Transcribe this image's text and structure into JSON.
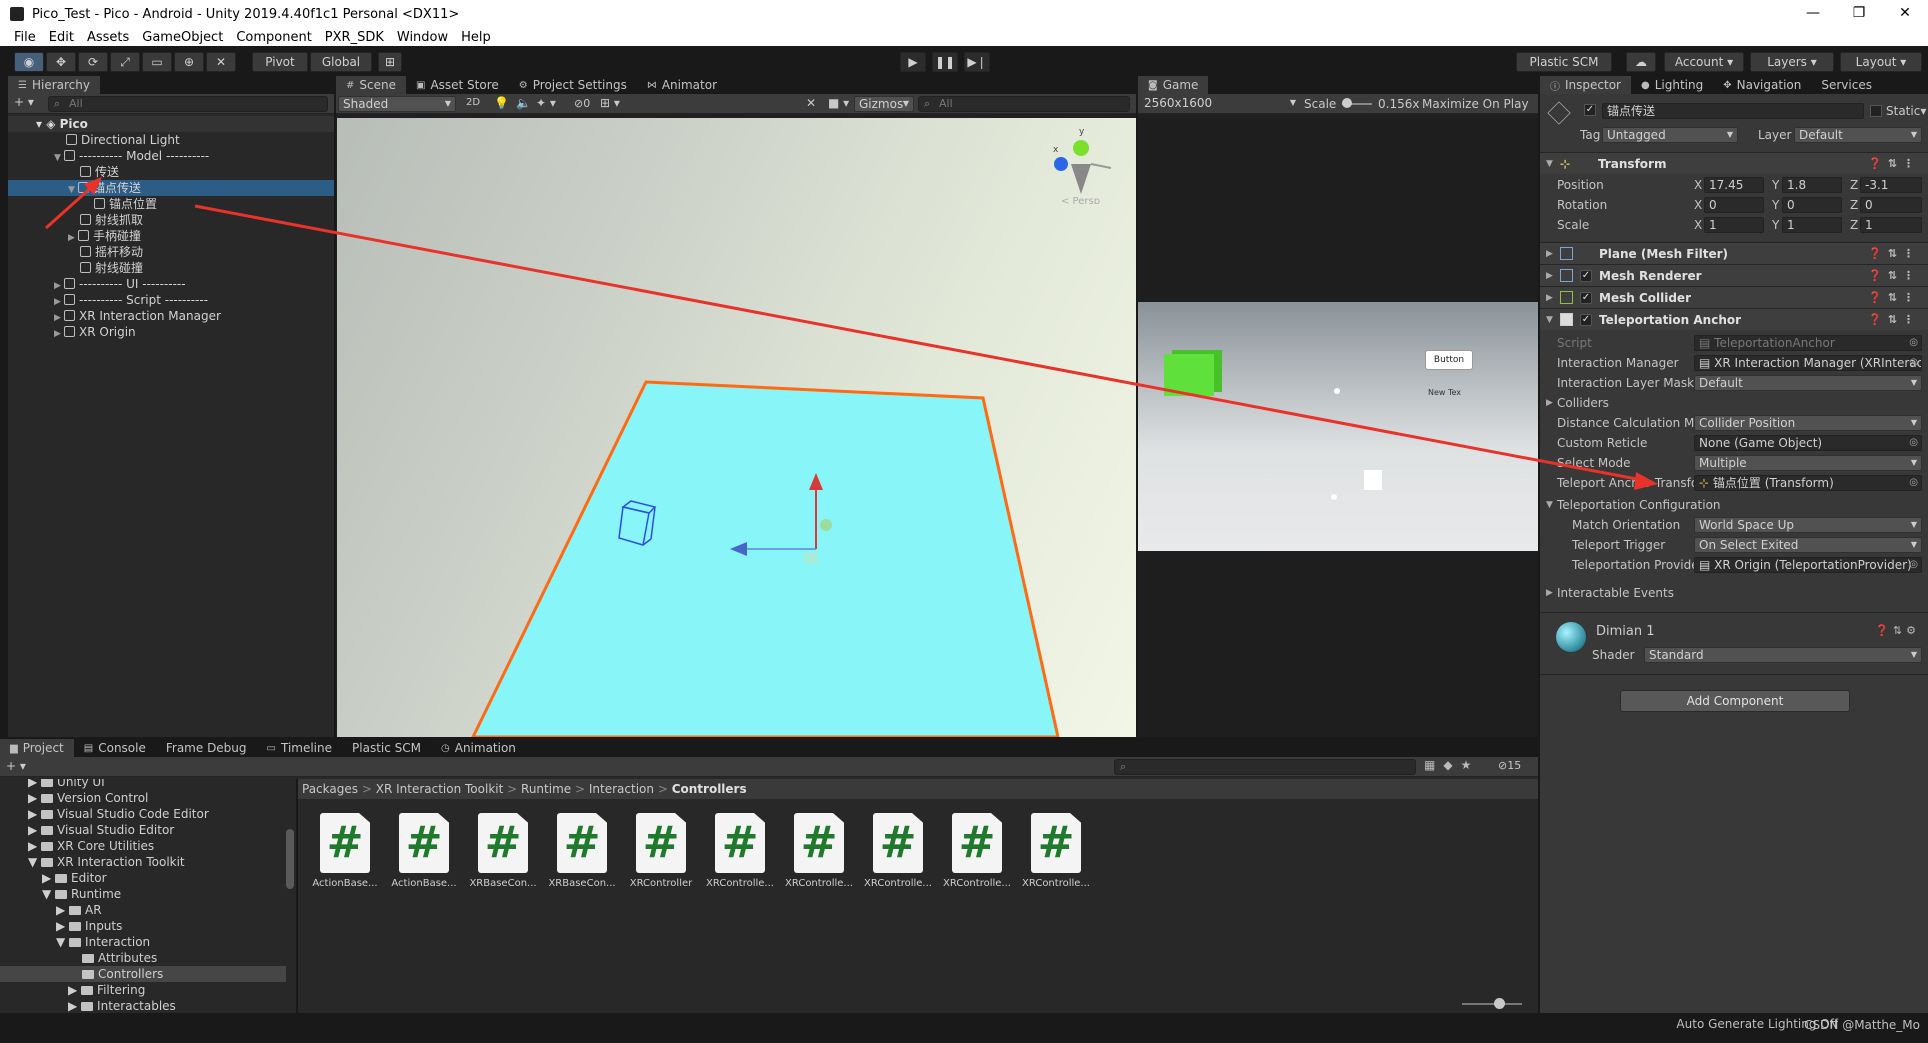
{
  "window": {
    "title": "Pico_Test - Pico - Android - Unity 2019.4.40f1c1 Personal <DX11>",
    "minimize": "—",
    "maximize": "❐",
    "close": "✕"
  },
  "menu": [
    "File",
    "Edit",
    "Assets",
    "GameObject",
    "Component",
    "PXR_SDK",
    "Window",
    "Help"
  ],
  "toolbar": {
    "pivot": "Pivot",
    "global": "Global",
    "plastic": "Plastic SCM",
    "account": "Account",
    "layers": "Layers",
    "layout": "Layout"
  },
  "hierarchy": {
    "tab": "Hierarchy",
    "search_placeholder": "All",
    "root": "Pico",
    "items": [
      {
        "label": "Directional Light"
      },
      {
        "label": "---------- Model ----------"
      },
      {
        "label": "传送"
      },
      {
        "label": "锚点传送"
      },
      {
        "label": "锚点位置"
      },
      {
        "label": "射线抓取"
      },
      {
        "label": "手柄碰撞"
      },
      {
        "label": "摇杆移动"
      },
      {
        "label": "射线碰撞"
      },
      {
        "label": "---------- UI ----------"
      },
      {
        "label": "---------- Script ----------"
      },
      {
        "label": "XR Interaction Manager"
      },
      {
        "label": "XR Origin"
      }
    ]
  },
  "scene_tabs": {
    "scene": "Scene",
    "asset_store": "Asset Store",
    "project_settings": "Project Settings",
    "animator": "Animator"
  },
  "scene_bar": {
    "shading": "Shaded",
    "mode2d": "2D",
    "hidden": "0",
    "gizmos": "Gizmos",
    "search": "All",
    "persp": "< Persp"
  },
  "gizmo_axes": {
    "y": "y",
    "x": "x"
  },
  "game": {
    "tab": "Game",
    "resolution": "2560x1600",
    "scale_label": "Scale",
    "scale_value": "0.156x",
    "maximize": "Maximize On Play",
    "button_text": "Button",
    "new_text": "New Tex"
  },
  "inspector": {
    "tabs": {
      "inspector": "Inspector",
      "lighting": "Lighting",
      "navigation": "Navigation",
      "services": "Services"
    },
    "object_name": "锚点传送",
    "static": "Static",
    "tag_label": "Tag",
    "tag_value": "Untagged",
    "layer_label": "Layer",
    "layer_value": "Default",
    "transform": {
      "title": "Transform",
      "position_label": "Position",
      "rotation_label": "Rotation",
      "scale_label": "Scale",
      "px": "17.45",
      "py": "1.8",
      "pz": "-3.1",
      "rx": "0",
      "ry": "0",
      "rz": "0",
      "sx": "1",
      "sy": "1",
      "sz": "1",
      "x": "X",
      "y": "Y",
      "z": "Z"
    },
    "components": {
      "plane": "Plane (Mesh Filter)",
      "renderer": "Mesh Renderer",
      "collider": "Mesh Collider",
      "anchor": "Teleportation Anchor"
    },
    "anchor_props": {
      "script_label": "Script",
      "script_value": "TeleportationAnchor",
      "im_label": "Interaction Manager",
      "im_value": "XR Interaction Manager (XRInterac",
      "mask_label": "Interaction Layer Mask",
      "mask_value": "Default",
      "colliders_label": "Colliders",
      "dist_label": "Distance Calculation Mc",
      "dist_value": "Collider Position",
      "reticle_label": "Custom Reticle",
      "reticle_value": "None (Game Object)",
      "select_label": "Select Mode",
      "select_value": "Multiple",
      "anchor_label": "Teleport Anchor Transfo",
      "anchor_value": "锚点位置 (Transform)",
      "config_label": "Teleportation Configuration",
      "match_label": "Match Orientation",
      "match_value": "World Space Up",
      "trigger_label": "Teleport Trigger",
      "trigger_value": "On Select Exited",
      "provider_label": "Teleportation Provide",
      "provider_value": "XR Origin (TeleportationProvider)",
      "events_label": "Interactable Events"
    },
    "material": {
      "name": "Dimian 1",
      "shader_label": "Shader",
      "shader_value": "Standard"
    },
    "add_component": "Add Component"
  },
  "bottom": {
    "tabs": {
      "project": "Project",
      "console": "Console",
      "frame_debug": "Frame Debug",
      "timeline": "Timeline",
      "plastic": "Plastic SCM",
      "animation": "Animation"
    },
    "tree": [
      {
        "label": "Unity UI"
      },
      {
        "label": "Version Control"
      },
      {
        "label": "Visual Studio Code Editor"
      },
      {
        "label": "Visual Studio Editor"
      },
      {
        "label": "XR Core Utilities"
      },
      {
        "label": "XR Interaction Toolkit"
      },
      {
        "label": "Editor"
      },
      {
        "label": "Runtime"
      },
      {
        "label": "AR"
      },
      {
        "label": "Inputs"
      },
      {
        "label": "Interaction"
      },
      {
        "label": "Attributes"
      },
      {
        "label": "Controllers"
      },
      {
        "label": "Filtering"
      },
      {
        "label": "Interactables"
      }
    ],
    "breadcrumb": {
      "b0": "Packages",
      "b1": "XR Interaction Toolkit",
      "b2": "Runtime",
      "b3": "Interaction",
      "b4": "Controllers",
      "sep": ">"
    },
    "hidden_count": "15",
    "assets": [
      {
        "glyph": "#",
        "name": "ActionBase..."
      },
      {
        "glyph": "#",
        "name": "ActionBase..."
      },
      {
        "glyph": "#",
        "name": "XRBaseCon..."
      },
      {
        "glyph": "#",
        "name": "XRBaseCon..."
      },
      {
        "glyph": "#",
        "name": "XRController"
      },
      {
        "glyph": "#",
        "name": "XRControlle..."
      },
      {
        "glyph": "#",
        "name": "XRControlle..."
      },
      {
        "glyph": "#",
        "name": "XRControlle..."
      },
      {
        "glyph": "#",
        "name": "XRControlle..."
      },
      {
        "glyph": "#",
        "name": "XRControlle..."
      }
    ]
  },
  "status": {
    "text": "Auto Generate Lighting Off",
    "watermark": "CSDN @Matthe_Mo"
  },
  "colors": {
    "selection": "#2c5d87",
    "plane": "#88f5f8",
    "plane_edge": "#ff6a12",
    "annotation": "#e8322a"
  }
}
